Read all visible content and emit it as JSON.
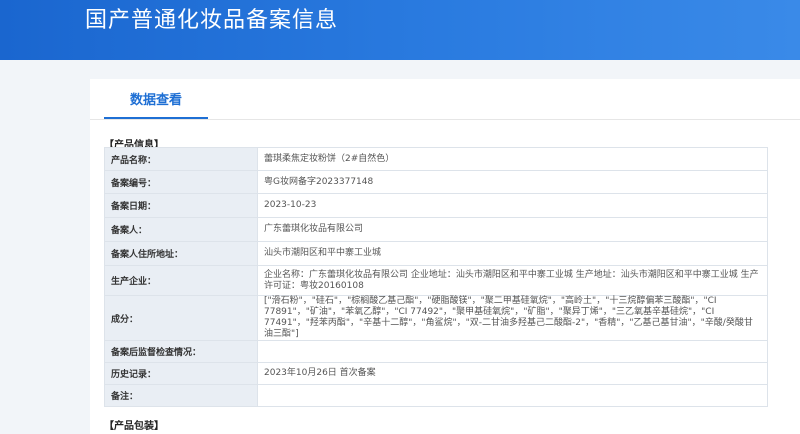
{
  "header": {
    "title": "国产普通化妆品备案信息"
  },
  "tabs": [
    {
      "label": "数据查看"
    }
  ],
  "sections": {
    "product_info": "【产品信息】",
    "product_packaging": "【产品包装】"
  },
  "rows": [
    {
      "label": "产品名称：",
      "value": "蕾琪柔焦定妆粉饼（2#自然色）"
    },
    {
      "label": "备案编号：",
      "value": "粤G妆网备字2023377148"
    },
    {
      "label": "备案日期：",
      "value": "2023-10-23"
    },
    {
      "label": "备案人：",
      "value": "广东蕾琪化妆品有限公司"
    },
    {
      "label": "备案人住所地址：",
      "value": "汕头市潮阳区和平中寨工业城"
    },
    {
      "label": "生产企业：",
      "value": "企业名称：广东蕾琪化妆品有限公司 企业地址：汕头市潮阳区和平中寨工业城 生产地址：汕头市潮阳区和平中寨工业城 生产许可证：粤妆20160108"
    },
    {
      "label": "成分：",
      "value": "[\"滑石粉\"，\"硅石\"，\"棕榈酸乙基己酯\"，\"硬脂酸镁\"，\"聚二甲基硅氧烷\"，\"高岭土\"，\"十三烷醇偏苯三酸酯\"，\"CI 77891\"，\"矿油\"，\"苯氧乙醇\"，\"CI 77492\"，\"聚甲基硅氧烷\"，\"矿脂\"，\"聚异丁烯\"，\"三乙氧基辛基硅烷\"，\"CI 77491\"，\"羟苯丙酯\"，\"辛基十二醇\"，\"角鲨烷\"，\"双-二甘油多羟基己二酸酯-2\"，\"香精\"，\"乙基己基甘油\"，\"辛酸/癸酸甘油三酯\"]"
    },
    {
      "label": "备案后监督检查情况：",
      "value": ""
    },
    {
      "label": "历史记录：",
      "value": "2023年10月26日 首次备案"
    },
    {
      "label": "备注：",
      "value": ""
    }
  ]
}
